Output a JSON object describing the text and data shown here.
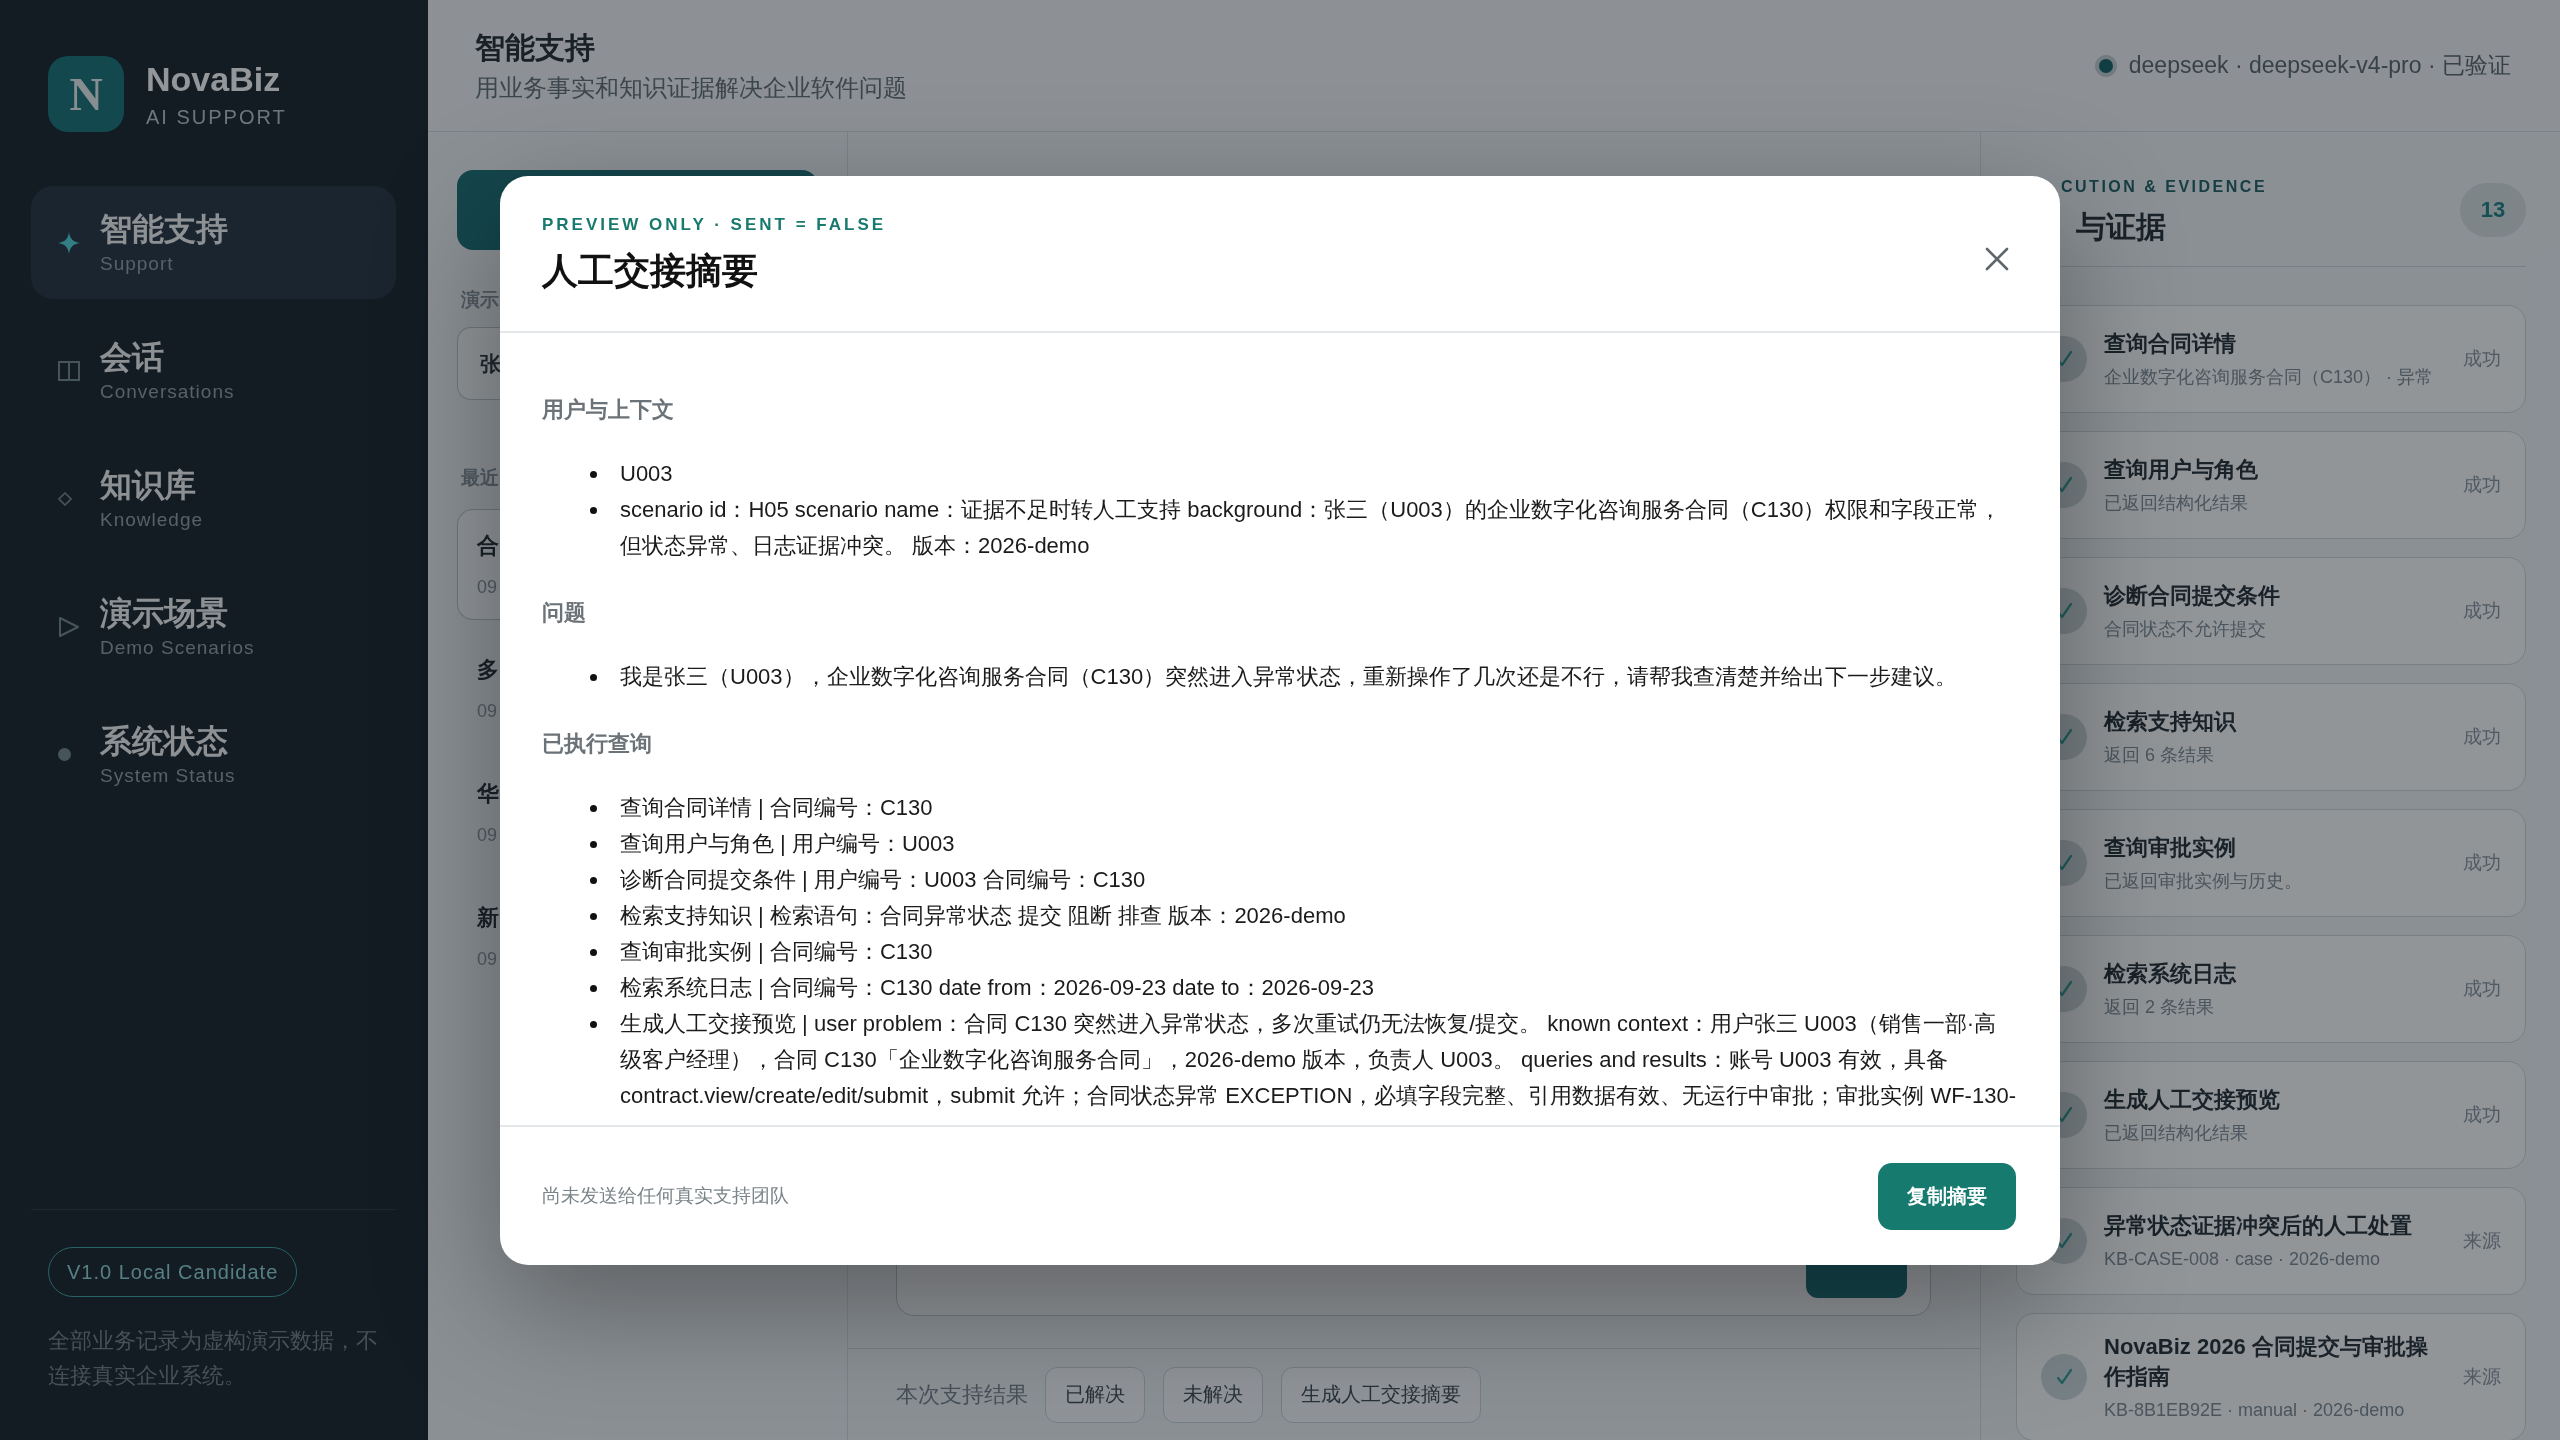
{
  "sidebar": {
    "brand": {
      "logo": "N",
      "name": "NovaBiz",
      "tagline": "AI SUPPORT"
    },
    "nav": [
      {
        "label": "智能支持",
        "sublabel": "Support",
        "selected": true
      },
      {
        "label": "会话",
        "sublabel": "Conversations",
        "selected": false
      },
      {
        "label": "知识库",
        "sublabel": "Knowledge",
        "selected": false
      },
      {
        "label": "演示场景",
        "sublabel": "Demo Scenarios",
        "selected": false
      },
      {
        "label": "系统状态",
        "sublabel": "System Status",
        "selected": false
      }
    ],
    "version_badge": "V1.0 Local Candidate",
    "note": "全部业务记录为虚构演示数据，不连接真实企业系统。"
  },
  "header": {
    "title": "智能支持",
    "subtitle": "用业务事实和知识证据解决企业软件问题",
    "model_status": "deepseek · deepseek-v4-pro · 已验证"
  },
  "left_panel": {
    "scenario_label": "演示",
    "scenario_select": {
      "value": "张"
    },
    "recent_label": "最近",
    "conversations": [
      {
        "title": "合",
        "time": "09",
        "selected": true
      },
      {
        "title": "多",
        "time": "09",
        "selected": false
      },
      {
        "title": "华",
        "time": "09",
        "selected": false
      },
      {
        "title": "新",
        "time": "09",
        "selected": false
      }
    ]
  },
  "session": {
    "outcome_label": "本次支持结果",
    "outcome_buttons": [
      "已解决",
      "未解决",
      "生成人工交接摘要"
    ]
  },
  "evidence_panel": {
    "eyebrow": "CUTION & EVIDENCE",
    "title": "与证据",
    "count": "13",
    "steps": [
      {
        "title": "查询合同详情",
        "detail": "企业数字化咨询服务合同（C130） · 异常",
        "status": "成功"
      },
      {
        "title": "查询用户与角色",
        "detail": "已返回结构化结果",
        "status": "成功"
      },
      {
        "title": "诊断合同提交条件",
        "detail": "合同状态不允许提交",
        "status": "成功"
      },
      {
        "title": "检索支持知识",
        "detail": "返回 6 条结果",
        "status": "成功"
      },
      {
        "title": "查询审批实例",
        "detail": "已返回审批实例与历史。",
        "status": "成功"
      },
      {
        "title": "检索系统日志",
        "detail": "返回 2 条结果",
        "status": "成功"
      },
      {
        "title": "生成人工交接预览",
        "detail": "已返回结构化结果",
        "status": "成功"
      },
      {
        "title": "异常状态证据冲突后的人工处置",
        "detail": "KB-CASE-008 · case · 2026-demo",
        "status": "来源"
      },
      {
        "title": "NovaBiz 2026 合同提交与审批操作指南",
        "detail": "KB-8B1EB92E · manual · 2026-demo",
        "status": "来源"
      }
    ]
  },
  "modal": {
    "eyebrow": "PREVIEW ONLY · SENT = FALSE",
    "title": "人工交接摘要",
    "sections": [
      {
        "heading": "用户与上下文",
        "items": [
          "U003",
          "scenario id：H05 scenario name：证据不足时转人工支持 background：张三（U003）的企业数字化咨询服务合同（C130）权限和字段正常，但状态异常、日志证据冲突。 版本：2026-demo"
        ]
      },
      {
        "heading": "问题",
        "items": [
          "我是张三（U003），企业数字化咨询服务合同（C130）突然进入异常状态，重新操作了几次还是不行，请帮我查清楚并给出下一步建议。"
        ]
      },
      {
        "heading": "已执行查询",
        "items": [
          "查询合同详情 | 合同编号：C130",
          "查询用户与角色 | 用户编号：U003",
          "诊断合同提交条件 | 用户编号：U003 合同编号：C130",
          "检索支持知识 | 检索语句：合同异常状态 提交 阻断 排查 版本：2026-demo",
          "查询审批实例 | 合同编号：C130",
          "检索系统日志 | 合同编号：C130 date from：2026-09-23 date to：2026-09-23",
          "生成人工交接预览 | user problem：合同 C130 突然进入异常状态，多次重试仍无法恢复/提交。 known context：用户张三 U003（销售一部·高级客户经理），合同 C130「企业数字化咨询服务合同」，2026-demo 版本，负责人 U003。 queries and results：账号 U003 有效，具备 contract.view/create/edit/submit，submit 允许；合同状态异常 EXCEPTION，必填字段完整、引用数据有效、无运行中审批；审批实例 WF-130-"
        ]
      }
    ],
    "footer_note": "尚未发送给任何真实支持团队",
    "copy_button": "复制摘要"
  }
}
